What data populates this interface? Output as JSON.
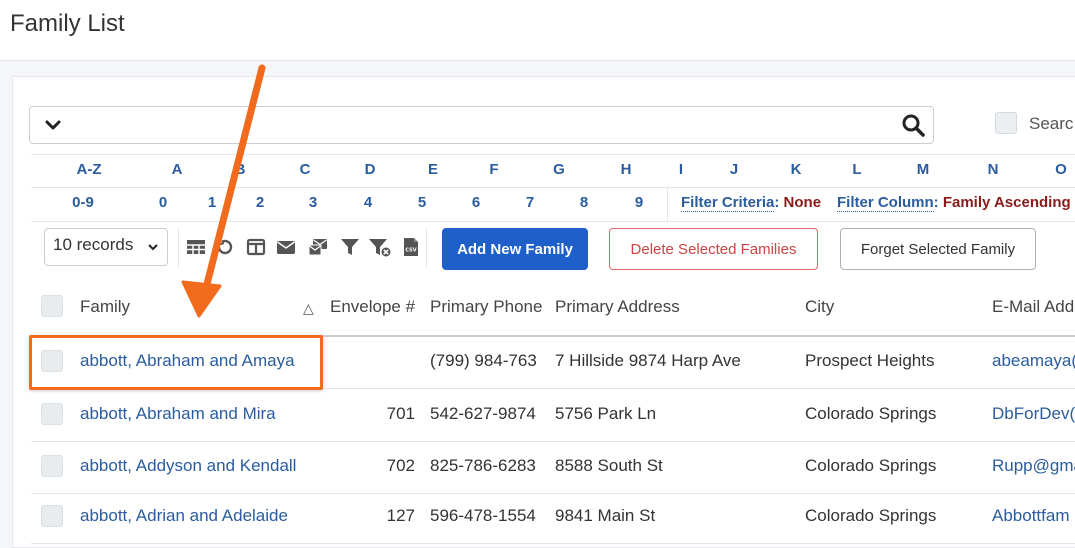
{
  "page": {
    "title": "Family List"
  },
  "search": {
    "placeholder": "",
    "label": "Searc"
  },
  "alphabet": {
    "letters": [
      "A-Z",
      "A",
      "B",
      "C",
      "D",
      "E",
      "F",
      "G",
      "H",
      "I",
      "J",
      "K",
      "L",
      "M",
      "N",
      "O"
    ],
    "numbers": [
      "0-9",
      "0",
      "1",
      "2",
      "3",
      "4",
      "5",
      "6",
      "7",
      "8",
      "9"
    ]
  },
  "filters": {
    "criteria_label": "Filter Criteria",
    "criteria_value": "None",
    "column_label": "Filter Column",
    "column_value": "Family Ascending"
  },
  "toolbar": {
    "records_select": "10 records",
    "icons": [
      "table-icon",
      "undo-icon",
      "columns-icon",
      "envelope-icon",
      "mail-merge-icon",
      "filter-icon",
      "clear-filter-icon",
      "csv-icon"
    ],
    "add_label": "Add New Family",
    "delete_label": "Delete Selected Families",
    "forget_label": "Forget Selected Family"
  },
  "table": {
    "columns": [
      "Family",
      "Envelope #",
      "Primary Phone",
      "Primary Address",
      "City",
      "E-Mail Add"
    ],
    "sort_indicator": "△",
    "rows": [
      {
        "family": "abbott, Abraham and Amaya",
        "envelope": "",
        "phone": "(799) 984-763",
        "address": "7 Hillside 9874 Harp Ave",
        "city": "Prospect Heights",
        "email": "abeamaya("
      },
      {
        "family": "abbott, Abraham and Mira",
        "envelope": "701",
        "phone": "542-627-9874",
        "address": "5756 Park Ln",
        "city": "Colorado Springs",
        "email": "DbForDev("
      },
      {
        "family": "abbott, Addyson and Kendall",
        "envelope": "702",
        "phone": "825-786-6283",
        "address": "8588 South St",
        "city": "Colorado Springs",
        "email": "Rupp@gma"
      },
      {
        "family": "abbott, Adrian and Adelaide",
        "envelope": "127",
        "phone": "596-478-1554",
        "address": "9841 Main St",
        "city": "Colorado Springs",
        "email": "Abbottfam"
      }
    ]
  },
  "colors": {
    "accent": "#1f5fc9",
    "link": "#2a5c9e",
    "danger": "#c44",
    "highlight": "#f26a1b",
    "filter_value": "#8b1a1a"
  }
}
